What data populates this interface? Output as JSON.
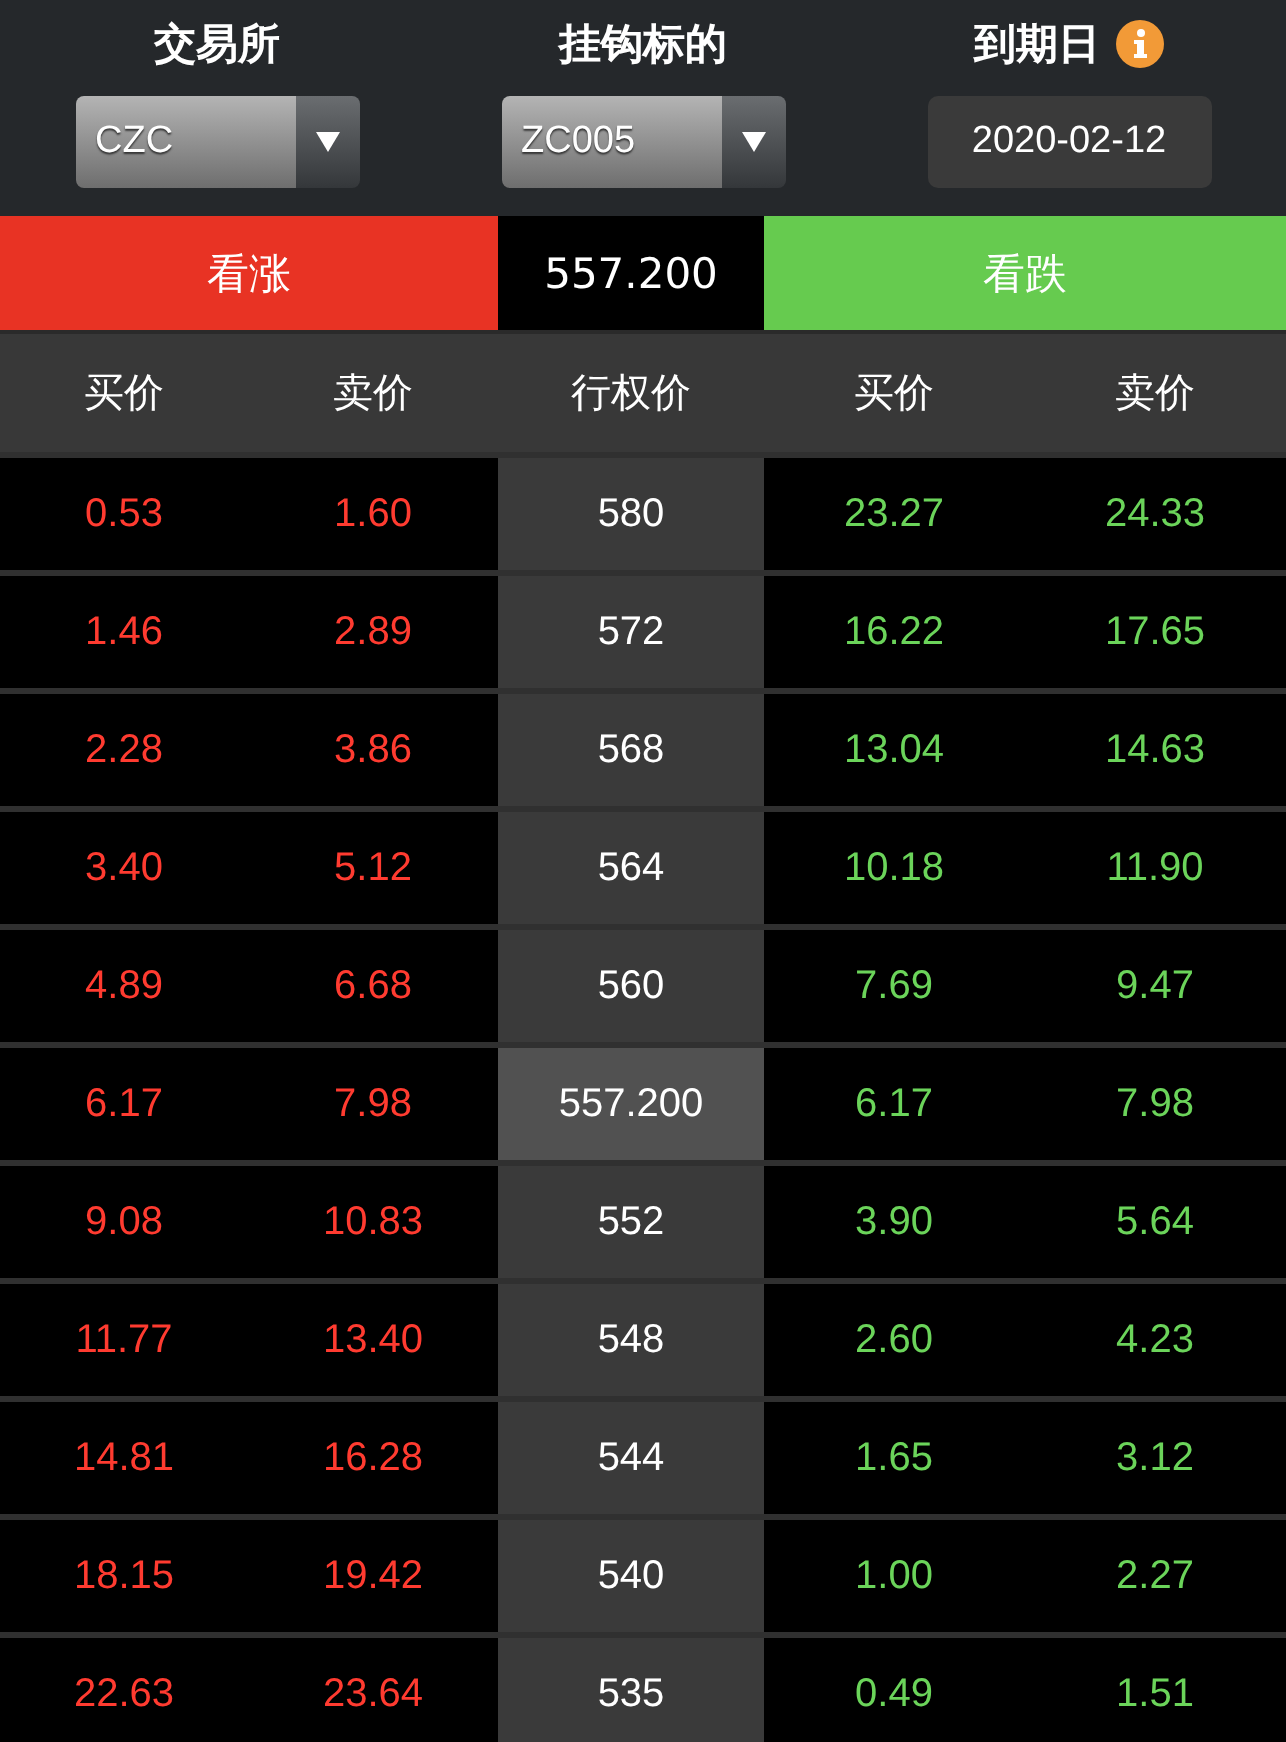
{
  "filters": [
    {
      "kind": "select",
      "label": "交易所",
      "value": "CZC"
    },
    {
      "kind": "select",
      "label": "挂钩标的",
      "value": "ZC005"
    },
    {
      "kind": "date",
      "label": "到期日",
      "value": "2020-02-12",
      "info": true
    }
  ],
  "sides": {
    "call": "看涨",
    "underlying_price": "557.200",
    "put": "看跌"
  },
  "columns": [
    "买价",
    "卖价",
    "行权价",
    "买价",
    "卖价"
  ],
  "rows": [
    {
      "call_bid": "0.53",
      "call_ask": "1.60",
      "strike": "580",
      "put_bid": "23.27",
      "put_ask": "24.33",
      "current": false
    },
    {
      "call_bid": "1.46",
      "call_ask": "2.89",
      "strike": "572",
      "put_bid": "16.22",
      "put_ask": "17.65",
      "current": false
    },
    {
      "call_bid": "2.28",
      "call_ask": "3.86",
      "strike": "568",
      "put_bid": "13.04",
      "put_ask": "14.63",
      "current": false
    },
    {
      "call_bid": "3.40",
      "call_ask": "5.12",
      "strike": "564",
      "put_bid": "10.18",
      "put_ask": "11.90",
      "current": false
    },
    {
      "call_bid": "4.89",
      "call_ask": "6.68",
      "strike": "560",
      "put_bid": "7.69",
      "put_ask": "9.47",
      "current": false
    },
    {
      "call_bid": "6.17",
      "call_ask": "7.98",
      "strike": "557.200",
      "put_bid": "6.17",
      "put_ask": "7.98",
      "current": true
    },
    {
      "call_bid": "9.08",
      "call_ask": "10.83",
      "strike": "552",
      "put_bid": "3.90",
      "put_ask": "5.64",
      "current": false
    },
    {
      "call_bid": "11.77",
      "call_ask": "13.40",
      "strike": "548",
      "put_bid": "2.60",
      "put_ask": "4.23",
      "current": false
    },
    {
      "call_bid": "14.81",
      "call_ask": "16.28",
      "strike": "544",
      "put_bid": "1.65",
      "put_ask": "3.12",
      "current": false
    },
    {
      "call_bid": "18.15",
      "call_ask": "19.42",
      "strike": "540",
      "put_bid": "1.00",
      "put_ask": "2.27",
      "current": false
    },
    {
      "call_bid": "22.63",
      "call_ask": "23.64",
      "strike": "535",
      "put_bid": "0.49",
      "put_ask": "1.51",
      "current": false
    }
  ]
}
